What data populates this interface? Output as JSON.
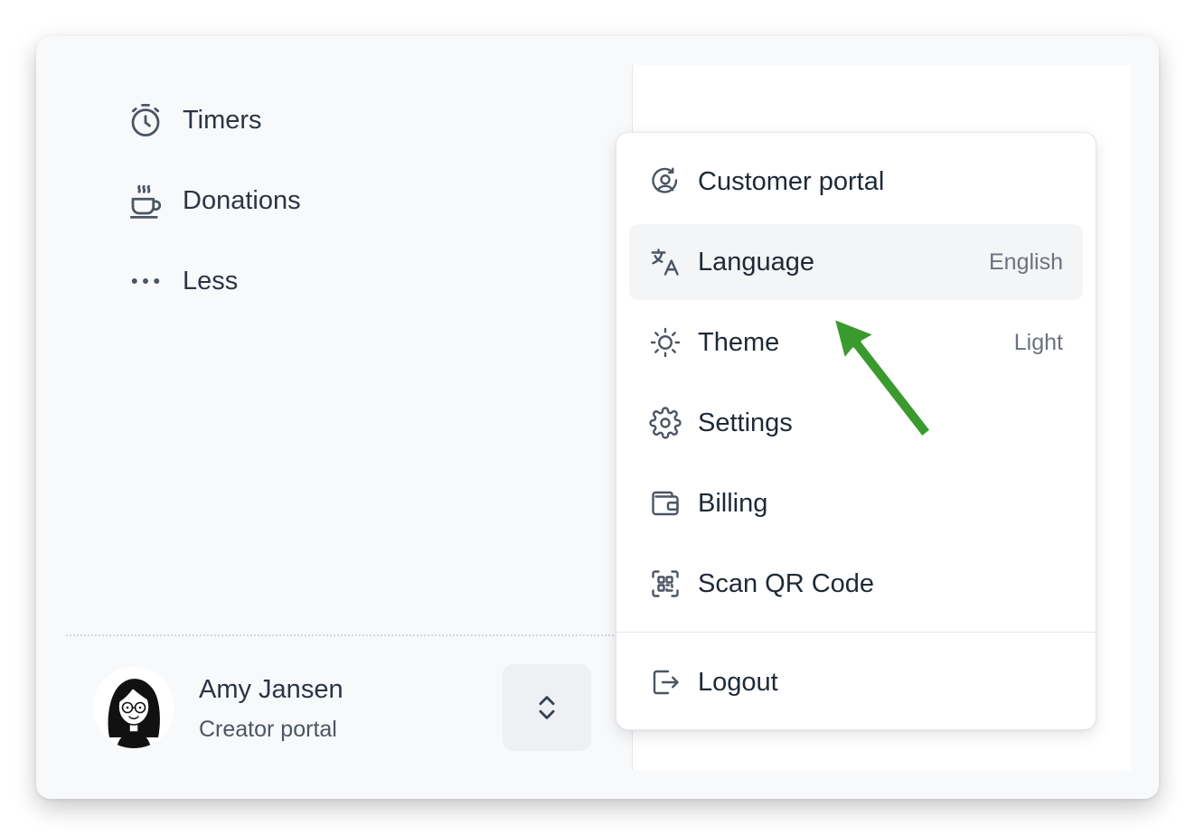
{
  "nav": {
    "items": [
      {
        "label": "Timers",
        "icon": "stopwatch-icon"
      },
      {
        "label": "Donations",
        "icon": "coffee-cup-icon"
      },
      {
        "label": "Less",
        "icon": "more-dots-icon"
      }
    ]
  },
  "user": {
    "name": "Amy Jansen",
    "role": "Creator portal",
    "avatar_icon": "avatar-illustration"
  },
  "menu": {
    "items": [
      {
        "label": "Customer portal",
        "value": "",
        "icon": "user-circle-refresh-icon"
      },
      {
        "label": "Language",
        "value": "English",
        "icon": "translate-icon",
        "active": true
      },
      {
        "label": "Theme",
        "value": "Light",
        "icon": "sun-icon"
      },
      {
        "label": "Settings",
        "value": "",
        "icon": "gear-icon"
      },
      {
        "label": "Billing",
        "value": "",
        "icon": "wallet-icon"
      },
      {
        "label": "Scan QR Code",
        "value": "",
        "icon": "qr-scan-icon"
      }
    ],
    "logout": {
      "label": "Logout",
      "icon": "logout-icon"
    }
  },
  "colors": {
    "annotation_arrow": "#3a9a2d",
    "hover_background": "#f4f5f7",
    "text_primary": "#1f2937",
    "text_secondary": "#6b7280"
  }
}
